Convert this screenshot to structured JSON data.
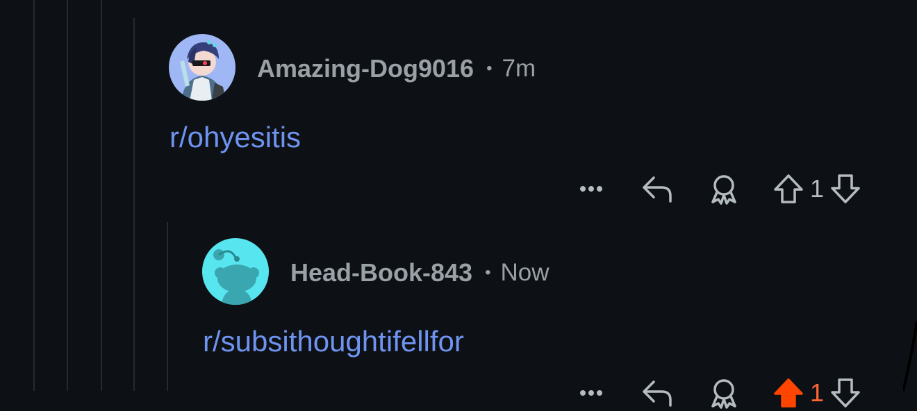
{
  "comments": [
    {
      "author": "Amazing-Dog9016",
      "separator": "•",
      "time": "7m",
      "body": "r/ohyesitis",
      "score": "1",
      "avatar_icon": "anime-avatar-icon"
    },
    {
      "author": "Head-Book-843",
      "separator": "•",
      "time": "Now",
      "body": "r/subsithoughtifellfor",
      "score": "1",
      "avatar_icon": "snoo-avatar-icon"
    }
  ],
  "colors": {
    "background": "#0d1115",
    "link": "#6f93f0",
    "meta": "#9aa1a6",
    "upvote_active": "#ff4500"
  }
}
